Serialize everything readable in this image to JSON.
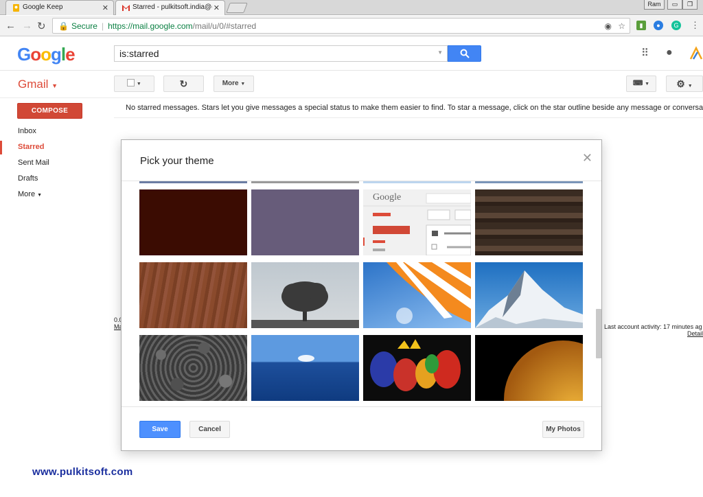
{
  "browser": {
    "tabs": [
      {
        "title": "Google Keep",
        "icon": "keep-icon"
      },
      {
        "title": "Starred - pulkitsoft.india@g",
        "icon": "gmail-icon"
      }
    ],
    "profile_name": "Ram",
    "url": {
      "secure_label": "Secure",
      "host": "https://mail.google.com",
      "path": "/mail/u/0/#starred"
    }
  },
  "gmail": {
    "logo": [
      "G",
      "o",
      "o",
      "g",
      "l",
      "e"
    ],
    "logo_colors": [
      "#4285f4",
      "#ea4335",
      "#fbbc05",
      "#4285f4",
      "#34a853",
      "#ea4335"
    ],
    "search_value": "is:starred",
    "app_label": "Gmail",
    "toolbar": {
      "more_label": "More"
    },
    "compose_label": "COMPOSE",
    "nav": {
      "inbox": "Inbox",
      "starred": "Starred",
      "sent": "Sent Mail",
      "drafts": "Drafts",
      "more": "More"
    },
    "notice": "No starred messages. Stars let you give messages a special status to make them easier to find. To star a message, click on the star outline beside any message or conversation.",
    "footer_left_1": "0.0",
    "footer_left_2": "Ma",
    "account_activity": "Last account activity: 17 minutes ag",
    "details_link": "Detail"
  },
  "theme_dialog": {
    "title": "Pick your theme",
    "save_label": "Save",
    "cancel_label": "Cancel",
    "my_photos_label": "My Photos",
    "thumb_google_text": "Google",
    "themes": [
      "dark-red",
      "slate-purple",
      "gmail-classic",
      "dark-wood",
      "brown-wood",
      "tree",
      "beach-umbrella",
      "mountain",
      "pebbles",
      "ocean",
      "graffiti",
      "planet"
    ]
  },
  "colors": {
    "gmail_red": "#dd4b39",
    "compose_red": "#d14836",
    "button_blue": "#4d90fe",
    "secure_green": "#0b8043"
  },
  "watermark": "www.pulkitsoft.com"
}
